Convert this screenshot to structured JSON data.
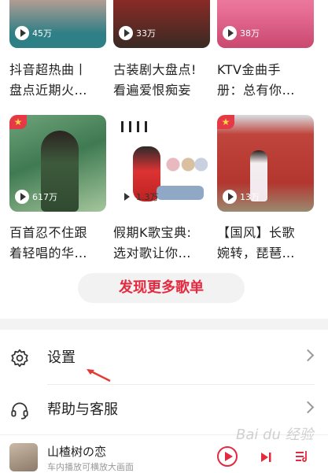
{
  "playlists": [
    {
      "title_line1": "抖音超热曲丨",
      "title_line2": "盘点近期火…",
      "plays": "45万",
      "featured": false
    },
    {
      "title_line1": "古装剧大盘点!",
      "title_line2": "看遍爱恨痴妄",
      "plays": "33万",
      "featured": false
    },
    {
      "title_line1": "KTV金曲手",
      "title_line2": "册：总有你…",
      "plays": "38万",
      "featured": false
    },
    {
      "title_line1": "百首忍不住跟",
      "title_line2": "着轻唱的华…",
      "plays": "617万",
      "featured": true
    },
    {
      "title_line1": "假期K歌宝典:",
      "title_line2": "选对歌让你…",
      "plays": "1.3万",
      "featured": false
    },
    {
      "title_line1": "【国风】长歌",
      "title_line2": "婉转，琵琶…",
      "plays": "13万",
      "featured": true
    }
  ],
  "discover_more": "发现更多歌单",
  "menu": {
    "settings": "设置",
    "help": "帮助与客服"
  },
  "player": {
    "song": "山楂树の恋",
    "subtitle": "车内播放可横放大画面"
  },
  "watermark": "Bai du 经验",
  "colors": {
    "accent": "#e32a40",
    "badge": "#e53945"
  },
  "icons": [
    "play-icon",
    "star-badge-icon",
    "gear-icon",
    "headset-icon",
    "chevron-right-icon",
    "play-circle-icon",
    "next-track-icon",
    "playlist-icon"
  ]
}
